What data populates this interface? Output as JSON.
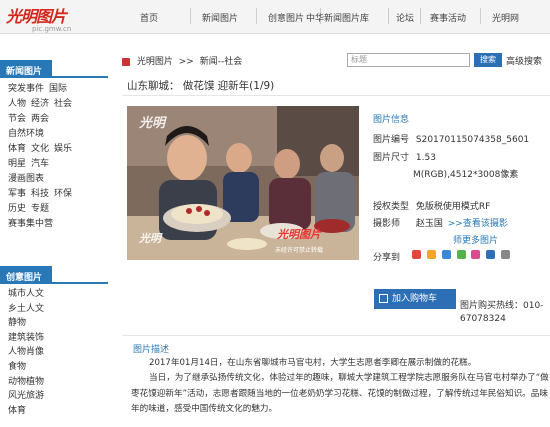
{
  "logo": {
    "main": "光明图片",
    "sub": "pic.gmw.cn"
  },
  "nav": [
    "首页",
    "新闻图片",
    "创意图片",
    "",
    "中华新闻图片库",
    "论坛",
    "赛事活动",
    "光明网"
  ],
  "sidebar": {
    "news_head": "新闻图片",
    "news_links": [
      [
        "突发事件",
        "国际"
      ],
      [
        "人物",
        "经济",
        "社会"
      ],
      [
        "节会",
        "两会"
      ],
      [
        "自然环境"
      ],
      [
        "体育",
        "文化",
        "娱乐"
      ],
      [
        "明星",
        "汽车"
      ],
      [
        "漫画图表"
      ],
      [
        "军事",
        "科技",
        "环保"
      ],
      [
        "历史",
        "专题"
      ],
      [
        "赛事集中营"
      ]
    ],
    "creative_head": "创意图片",
    "creative_links": [
      "城市人文",
      "乡土人文",
      "静物",
      "建筑装饰",
      "人物肖像",
      "食物",
      "动物植物",
      "风光旅游",
      "体育"
    ]
  },
  "breadcrumb": {
    "home": "光明图片",
    "sep1": ">>",
    "section": "新闻--社会"
  },
  "search": {
    "placeholder": "标题",
    "button": "搜索",
    "advanced": "高级搜索"
  },
  "photo_title": "山东聊城： 做花馍 迎新年(1/9)",
  "photo": {
    "watermark": "光明",
    "watermark_big": "光明图片",
    "watermark_note": "未经许可禁止转载"
  },
  "info": {
    "title": "图片信息",
    "id_label": "图片编号",
    "id_value": "S20170115074358_5601",
    "size_label": "图片尺寸",
    "size_value": "1.53",
    "size_unit": "M(RGB),4512*3008像素",
    "license_label": "授权类型",
    "license_value": "免版税使用模式RF",
    "photographer_label": "摄影师",
    "photographer_value": "赵玉国",
    "more_works": ">>查看该摄影",
    "more_works2": "师更多图片",
    "share_label": "分享到"
  },
  "cart": {
    "label": "加入购物车"
  },
  "hotline": "图片购买热线：010-67078324",
  "description": {
    "title": "图片描述",
    "para1": "2017年01月14日，在山东省聊城市马官屯村，大学生志愿者李卿在展示制做的花糕。",
    "para2": "当日，为了继承弘扬传统文化，体验过年的趣味，聊城大学建筑工程学院志愿服务队在马官屯村举办了“做枣花馍迎新年”活动，志愿者跟随当地的一位老奶奶学习花糕、花馍的制做过程，了解传统过年民俗知识。品味年的味道，感受中国传统文化的魅力。"
  },
  "colors": {
    "accent": "#2878b8",
    "brand_red": "#d7261d",
    "button_blue": "#2d6fb5"
  }
}
